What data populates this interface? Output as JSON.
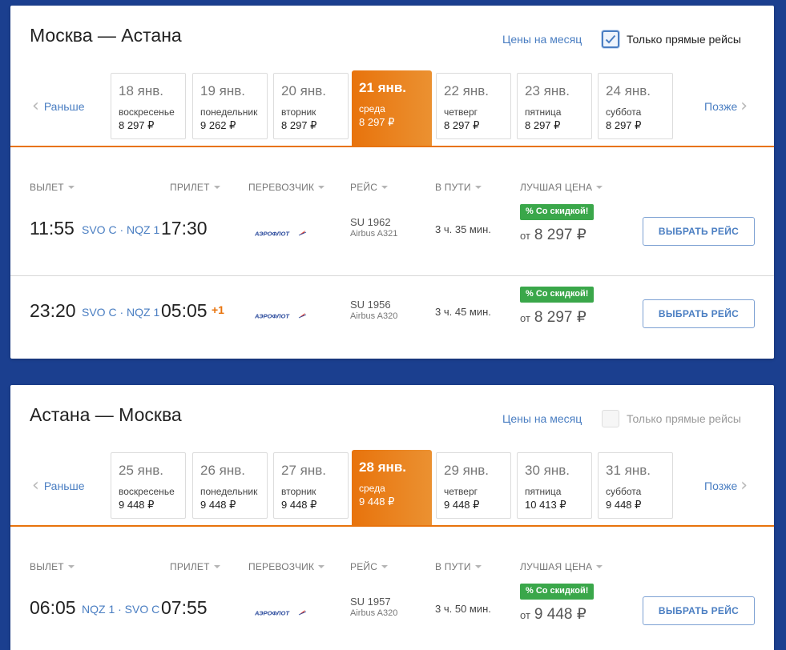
{
  "colors": {
    "page_bg": "#1b3f8f",
    "accent_orange": "#e8730c",
    "link_blue": "#4a7ec2",
    "deal_green": "#3aa74a"
  },
  "nav": {
    "prev_label": "Раньше",
    "next_label": "Позже",
    "prev_icon": "chevron-left-icon",
    "next_icon": "chevron-right-icon"
  },
  "columns": {
    "departure": "ВЫЛЕТ",
    "arrival": "ПРИЛЕТ",
    "carrier": "ПЕРЕВОЗЧИК",
    "flight": "РЕЙС",
    "duration": "В ПУТИ",
    "best_price": "ЛУЧШАЯ ЦЕНА"
  },
  "panels": [
    {
      "route_title": "Москва — Астана",
      "month_prices_link": "Цены на месяц",
      "direct_only_label": "Только прямые рейсы",
      "direct_only_checked": true,
      "dates": [
        {
          "date": "18 янв.",
          "dow": "воскресенье",
          "price": "8 297 ₽"
        },
        {
          "date": "19 янв.",
          "dow": "понедельник",
          "price": "9 262 ₽"
        },
        {
          "date": "20 янв.",
          "dow": "вторник",
          "price": "8 297 ₽"
        },
        {
          "date": "21 янв.",
          "dow": "среда",
          "price": "8 297 ₽",
          "selected": true
        },
        {
          "date": "22 янв.",
          "dow": "четверг",
          "price": "8 297 ₽"
        },
        {
          "date": "23 янв.",
          "dow": "пятница",
          "price": "8 297 ₽"
        },
        {
          "date": "24 янв.",
          "dow": "суббота",
          "price": "8 297 ₽"
        }
      ],
      "flights": [
        {
          "dep_time": "11:55",
          "airports": "SVO C · NQZ 1",
          "arr_time": "17:30",
          "plus_day": "",
          "carrier_logo": "АЭРОФЛОТ",
          "flight_no": "SU 1962",
          "aircraft": "Airbus A321",
          "duration": "3 ч. 35 мин.",
          "deal_badge": "% Со скидкой!",
          "price_from": "от",
          "price": "8 297 ₽",
          "select_label": "ВЫБРАТЬ РЕЙС"
        },
        {
          "dep_time": "23:20",
          "airports": "SVO C · NQZ 1",
          "arr_time": "05:05",
          "plus_day": "+1",
          "carrier_logo": "АЭРОФЛОТ",
          "flight_no": "SU 1956",
          "aircraft": "Airbus A320",
          "duration": "3 ч. 45 мин.",
          "deal_badge": "% Со скидкой!",
          "price_from": "от",
          "price": "8 297 ₽",
          "select_label": "ВЫБРАТЬ РЕЙС"
        }
      ]
    },
    {
      "route_title": "Астана — Москва",
      "month_prices_link": "Цены на месяц",
      "direct_only_label": "Только прямые рейсы",
      "direct_only_checked": false,
      "dates": [
        {
          "date": "25 янв.",
          "dow": "воскресенье",
          "price": "9 448 ₽"
        },
        {
          "date": "26 янв.",
          "dow": "понедельник",
          "price": "9 448 ₽"
        },
        {
          "date": "27 янв.",
          "dow": "вторник",
          "price": "9 448 ₽"
        },
        {
          "date": "28 янв.",
          "dow": "среда",
          "price": "9 448 ₽",
          "selected": true
        },
        {
          "date": "29 янв.",
          "dow": "четверг",
          "price": "9 448 ₽"
        },
        {
          "date": "30 янв.",
          "dow": "пятница",
          "price": "10 413 ₽"
        },
        {
          "date": "31 янв.",
          "dow": "суббота",
          "price": "9 448 ₽"
        }
      ],
      "flights": [
        {
          "dep_time": "06:05",
          "airports": "NQZ 1 · SVO C",
          "arr_time": "07:55",
          "plus_day": "",
          "carrier_logo": "АЭРОФЛОТ",
          "flight_no": "SU 1957",
          "aircraft": "Airbus A320",
          "duration": "3 ч. 50 мин.",
          "deal_badge": "% Со скидкой!",
          "price_from": "от",
          "price": "9 448 ₽",
          "select_label": "ВЫБРАТЬ РЕЙС"
        }
      ]
    }
  ]
}
